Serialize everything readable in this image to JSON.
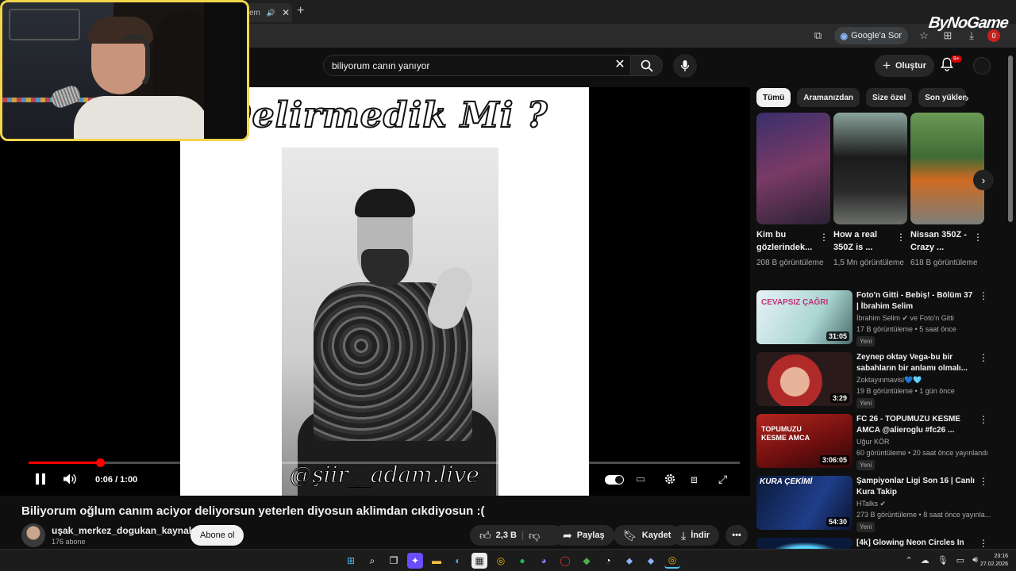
{
  "browser": {
    "tab_label": "em",
    "google_ask_label": "Google'a Sor",
    "profile_badge": "0"
  },
  "watermark": "ByNoGame",
  "header": {
    "search_value": "biliyorum canın yanıyor",
    "create_label": "Oluştur",
    "notifications_badge": "9+"
  },
  "player": {
    "overlay_title": "Delirmedik Mi ?",
    "overlay_handle": "@şiir__adam.live",
    "time_current": "0:06",
    "time_total": "1:00",
    "time_display": "0:06 / 1:00",
    "progress_fraction": 0.1
  },
  "video": {
    "title": "Biliyorum oğlum canım aciyor deliyorsun yeterlen diyosun aklimdan cıkdiyosun :(",
    "channel_name": "uşak_merkez_dogukan_kaynak",
    "channel_subs": "176 abone",
    "subscribe_label": "Abone ol",
    "likes": "2,3 B",
    "share_label": "Paylaş",
    "save_label": "Kaydet",
    "download_label": "İndir"
  },
  "sidebar": {
    "chips": [
      "Tümü",
      "Aramanızdan",
      "Size özel",
      "Son yüklenenler"
    ],
    "shorts": [
      {
        "title": "Kim bu gözlerindek...",
        "views": "208 B görüntüleme"
      },
      {
        "title": "How a real 350Z is ...",
        "views": "1,5 Mn görüntüleme"
      },
      {
        "title": "Nissan 350Z - Crazy ...",
        "views": "618 B görüntüleme"
      }
    ],
    "recommendations": [
      {
        "title": "Foto'n Gitti - Bebiş! - Bölüm 37 | İbrahim Selim",
        "channel": "İbrahim Selim ✔ ve Foto'n Gitti",
        "meta": "17 B görüntüleme • 5 saat önce",
        "badge": "Yeni",
        "duration": "31:05",
        "thumb_text": "CEVAPSIZ ÇAĞRI"
      },
      {
        "title": "Zeynep oktay Vega-bu bir sabahların bir anlamı olmalı...",
        "channel": "Zoktayınmavisi💙🩵",
        "meta": "19 B görüntüleme • 1 gün önce",
        "badge": "Yeni",
        "duration": "3:29",
        "thumb_text": ""
      },
      {
        "title": "FC 26 - TOPUMUZU KESME AMCA @alieroglu #fc26 ...",
        "channel": "Uğur KÖR",
        "meta": "60 görüntüleme • 20 saat önce yayınlandı",
        "badge": "Yeni",
        "duration": "3:06:05",
        "thumb_text": "TOPUMUZU KESME AMCA"
      },
      {
        "title": "Şampiyonlar Ligi Son 16 | Canlı Kura Takip",
        "channel": "HTalks ✔",
        "meta": "273 B görüntüleme • 8 saat önce yayınla...",
        "badge": "Yeni",
        "duration": "54:30",
        "thumb_text": "KURA ÇEKİMİ"
      },
      {
        "title": "[4k] Glowing Neon Circles In",
        "channel": "",
        "meta": "",
        "badge": "",
        "duration": "",
        "thumb_text": ""
      }
    ]
  },
  "taskbar": {
    "time": "23:16",
    "date": "27.02.2026"
  }
}
